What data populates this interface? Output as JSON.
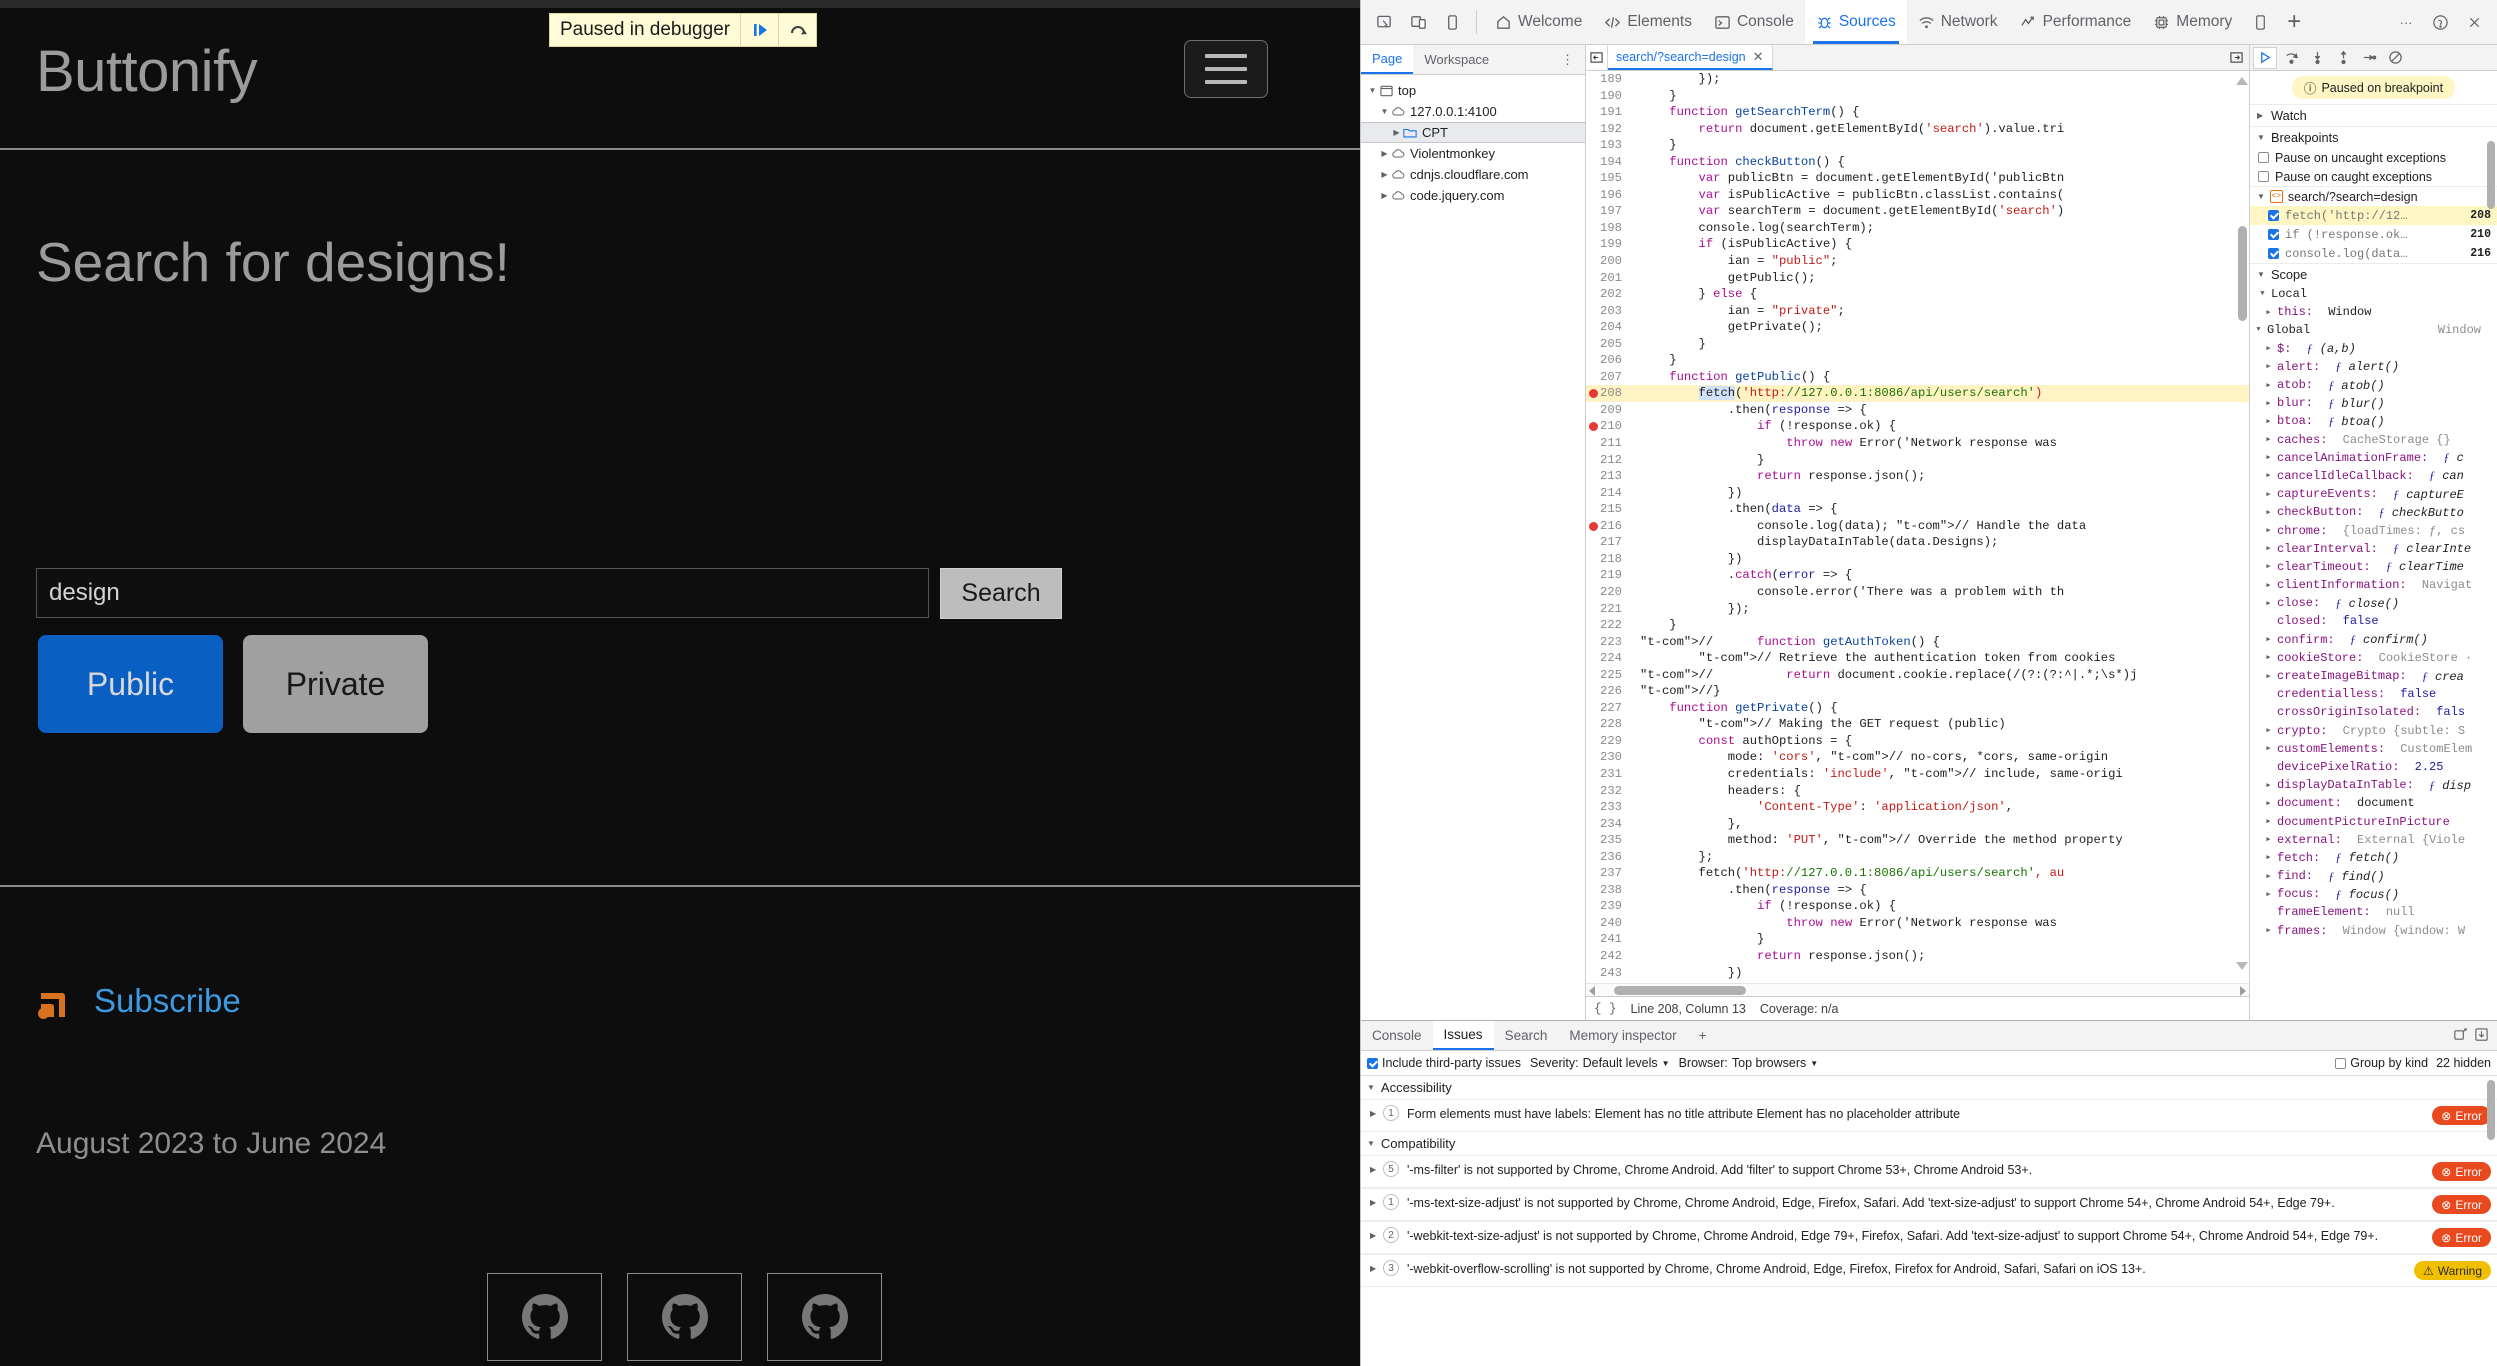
{
  "page": {
    "brand": "Buttonify",
    "paused_banner": {
      "label": "Paused in debugger",
      "resume_icon": "resume-icon",
      "step_icon": "step-over-icon"
    },
    "headline": "Search for designs!",
    "search": {
      "value": "design",
      "button": "Search"
    },
    "filters": [
      {
        "label": "Public",
        "active": true,
        "color": "#0a5fc2"
      },
      {
        "label": "Private",
        "active": false,
        "color": "#a0a0a0"
      }
    ],
    "footer": {
      "subscribe": "Subscribe",
      "dates": "August 2023 to June 2024",
      "github_links": [
        "github-icon",
        "github-icon",
        "github-icon"
      ]
    }
  },
  "devtools": {
    "toolbar": {
      "left_icons": [
        "inspect-element-icon",
        "device-toolbar-icon",
        "device-icon"
      ],
      "tabs": [
        {
          "label": "Welcome",
          "icon": "home-icon",
          "active": false
        },
        {
          "label": "Elements",
          "icon": "code-icon",
          "active": false
        },
        {
          "label": "Console",
          "icon": "console-icon",
          "active": false
        },
        {
          "label": "Sources",
          "icon": "bug-icon",
          "active": true
        },
        {
          "label": "Network",
          "icon": "network-icon",
          "active": false
        },
        {
          "label": "Performance",
          "icon": "performance-icon",
          "active": false
        },
        {
          "label": "Memory",
          "icon": "memory-icon",
          "active": false
        }
      ],
      "more_icon": "more-tabs-icon",
      "plus": "+",
      "right_icons": [
        "settings-more-icon",
        "help-icon",
        "close-icon"
      ]
    },
    "navigator": {
      "tabs": [
        {
          "label": "Page",
          "active": true
        },
        {
          "label": "Workspace",
          "active": false
        }
      ],
      "menu_icon": "kebab-menu-icon",
      "tree": [
        {
          "label": "top",
          "icon": "frame-icon",
          "depth": 0,
          "expanded": true,
          "selected": false
        },
        {
          "label": "127.0.0.1:4100",
          "icon": "cloud-icon",
          "depth": 1,
          "expanded": true,
          "selected": false
        },
        {
          "label": "CPT",
          "icon": "folder-icon",
          "depth": 2,
          "expanded": false,
          "selected": true
        },
        {
          "label": "Violentmonkey",
          "icon": "cloud-icon",
          "depth": 1,
          "expanded": false,
          "selected": false
        },
        {
          "label": "cdnjs.cloudflare.com",
          "icon": "cloud-icon",
          "depth": 1,
          "expanded": false,
          "selected": false
        },
        {
          "label": "code.jquery.com",
          "icon": "cloud-icon",
          "depth": 1,
          "expanded": false,
          "selected": false
        }
      ]
    },
    "editor": {
      "file_tab": "search/?search=design",
      "close_icon": "close-icon",
      "back_icon": "show-navigator-icon",
      "forward_icon": "show-debugger-icon",
      "status": {
        "brace": "{ }",
        "position": "Line 208, Column 13",
        "coverage": "Coverage: n/a"
      },
      "first_line": 189,
      "highlight_line": 208,
      "breakpoint_lines": [
        208,
        210,
        216
      ],
      "lines": [
        "        });",
        "    }",
        "    function getSearchTerm() {",
        "        return document.getElementById('search').value.tri",
        "    }",
        "    function checkButton() {",
        "        var publicBtn = document.getElementById('publicBtn",
        "        var isPublicActive = publicBtn.classList.contains(",
        "        var searchTerm = document.getElementById('search')",
        "        console.log(searchTerm);",
        "        if (isPublicActive) {",
        "            ian = \"public\";",
        "            getPublic();",
        "        } else {",
        "            ian = \"private\";",
        "            getPrivate();",
        "        }",
        "    }",
        "    function getPublic() {",
        "        fetch('http://127.0.0.1:8086/api/users/search')",
        "            .then(response => {",
        "                if (!response.ok) {",
        "                    throw new Error('Network response was",
        "                }",
        "                return response.json();",
        "            })",
        "            .then(data => {",
        "                console.log(data); // Handle the data",
        "                displayDataInTable(data.Designs);",
        "            })",
        "            .catch(error => {",
        "                console.error('There was a problem with th",
        "            });",
        "    }",
        "//      function getAuthToken() {",
        "        // Retrieve the authentication token from cookies",
        "//          return document.cookie.replace(/(?:(?:^|.*;\\s*)j",
        "//}",
        "    function getPrivate() {",
        "        // Making the GET request (public)",
        "        const authOptions = {",
        "            mode: 'cors', // no-cors, *cors, same-origin",
        "            credentials: 'include', // include, same-origi",
        "            headers: {",
        "                'Content-Type': 'application/json',",
        "            },",
        "            method: 'PUT', // Override the method property",
        "        };",
        "        fetch('http://127.0.0.1:8086/api/users/search', au",
        "            .then(response => {",
        "                if (!response.ok) {",
        "                    throw new Error('Network response was",
        "                }",
        "                return response.json();",
        "            })"
      ]
    },
    "debugger": {
      "controls": [
        "resume-icon",
        "step-over-icon",
        "step-into-icon",
        "step-out-icon",
        "step-icon",
        "deactivate-breakpoints-icon"
      ],
      "pause_status": {
        "icon": "info-icon",
        "label": "Paused on breakpoint"
      },
      "watch": {
        "label": "Watch",
        "expanded": false
      },
      "breakpoints": {
        "label": "Breakpoints",
        "expanded": true,
        "pause_uncaught": {
          "label": "Pause on uncaught exceptions",
          "checked": false
        },
        "pause_caught": {
          "label": "Pause on caught exceptions",
          "checked": false
        },
        "file": "search/?search=design",
        "items": [
          {
            "text": "fetch('http://12…",
            "line": "208",
            "checked": true,
            "active": true
          },
          {
            "text": "if (!response.ok…",
            "line": "210",
            "checked": true,
            "active": false
          },
          {
            "text": "console.log(data…",
            "line": "216",
            "checked": true,
            "active": false
          }
        ]
      },
      "scope": {
        "label": "Scope",
        "expanded": true,
        "groups": [
          {
            "name": "Local",
            "value": "",
            "expanded": true
          },
          {
            "name": "Global",
            "value": "Window",
            "expanded": true
          }
        ],
        "local_vars": [
          {
            "name": "this",
            "value": "Window",
            "kind": "plain",
            "expandable": true
          }
        ],
        "global_vars": [
          {
            "name": "$",
            "value": "ƒ (a,b)",
            "kind": "fn",
            "expandable": true
          },
          {
            "name": "alert",
            "value": "ƒ alert()",
            "kind": "fn",
            "expandable": true
          },
          {
            "name": "atob",
            "value": "ƒ atob()",
            "kind": "fn",
            "expandable": true
          },
          {
            "name": "blur",
            "value": "ƒ blur()",
            "kind": "fn",
            "expandable": true
          },
          {
            "name": "btoa",
            "value": "ƒ btoa()",
            "kind": "fn",
            "expandable": true
          },
          {
            "name": "caches",
            "value": "CacheStorage {}",
            "kind": "gray",
            "expandable": true
          },
          {
            "name": "cancelAnimationFrame",
            "value": "ƒ c",
            "kind": "fn",
            "expandable": true
          },
          {
            "name": "cancelIdleCallback",
            "value": "ƒ can",
            "kind": "fn",
            "expandable": true
          },
          {
            "name": "captureEvents",
            "value": "ƒ captureE",
            "kind": "fn",
            "expandable": true
          },
          {
            "name": "checkButton",
            "value": "ƒ checkButto",
            "kind": "fn",
            "expandable": true
          },
          {
            "name": "chrome",
            "value": "{loadTimes: ƒ, cs",
            "kind": "gray",
            "expandable": true
          },
          {
            "name": "clearInterval",
            "value": "ƒ clearInte",
            "kind": "fn",
            "expandable": true
          },
          {
            "name": "clearTimeout",
            "value": "ƒ clearTime",
            "kind": "fn",
            "expandable": true
          },
          {
            "name": "clientInformation",
            "value": "Navigat",
            "kind": "gray",
            "expandable": true
          },
          {
            "name": "close",
            "value": "ƒ close()",
            "kind": "fn",
            "expandable": true
          },
          {
            "name": "closed",
            "value": "false",
            "kind": "val",
            "expandable": false
          },
          {
            "name": "confirm",
            "value": "ƒ confirm()",
            "kind": "fn",
            "expandable": true
          },
          {
            "name": "cookieStore",
            "value": "CookieStore ·",
            "kind": "gray",
            "expandable": true
          },
          {
            "name": "createImageBitmap",
            "value": "ƒ crea",
            "kind": "fn",
            "expandable": true
          },
          {
            "name": "credentialless",
            "value": "false",
            "kind": "val",
            "expandable": false
          },
          {
            "name": "crossOriginIsolated",
            "value": "fals",
            "kind": "val",
            "expandable": false
          },
          {
            "name": "crypto",
            "value": "Crypto {subtle: S",
            "kind": "gray",
            "expandable": true
          },
          {
            "name": "customElements",
            "value": "CustomElem",
            "kind": "gray",
            "expandable": true
          },
          {
            "name": "devicePixelRatio",
            "value": "2.25",
            "kind": "val",
            "expandable": false
          },
          {
            "name": "displayDataInTable",
            "value": "ƒ disp",
            "kind": "fn",
            "expandable": true
          },
          {
            "name": "document",
            "value": "document",
            "kind": "plain",
            "expandable": true
          },
          {
            "name": "documentPictureInPicture",
            "value": "",
            "kind": "plain",
            "expandable": true
          },
          {
            "name": "external",
            "value": "External {Viole",
            "kind": "gray",
            "expandable": true
          },
          {
            "name": "fetch",
            "value": "ƒ fetch()",
            "kind": "fn",
            "expandable": true
          },
          {
            "name": "find",
            "value": "ƒ find()",
            "kind": "fn",
            "expandable": true
          },
          {
            "name": "focus",
            "value": "ƒ focus()",
            "kind": "fn",
            "expandable": true
          },
          {
            "name": "frameElement",
            "value": "null",
            "kind": "gray",
            "expandable": false
          },
          {
            "name": "frames",
            "value": "Window {window: W",
            "kind": "gray",
            "expandable": true
          }
        ]
      }
    },
    "drawer": {
      "tabs": [
        {
          "label": "Console",
          "active": false
        },
        {
          "label": "Issues",
          "active": true
        },
        {
          "label": "Search",
          "active": false
        },
        {
          "label": "Memory inspector",
          "active": false
        }
      ],
      "plus": "+",
      "right_icons": [
        "open-in-new-icon",
        "download-icon"
      ],
      "filters": {
        "include_third_party": {
          "label": "Include third-party issues",
          "checked": true
        },
        "severity": {
          "label": "Severity:",
          "value": "Default levels"
        },
        "browser": {
          "label": "Browser:",
          "value": "Top browsers"
        },
        "group_by_kind": {
          "label": "Group by kind",
          "checked": false
        },
        "hidden": "22 hidden"
      },
      "categories": [
        {
          "name": "Accessibility",
          "issues": [
            {
              "count": "1",
              "text": "Form elements must have labels: Element has no title attribute Element has no placeholder attribute",
              "severity": "Error"
            }
          ]
        },
        {
          "name": "Compatibility",
          "issues": [
            {
              "count": "5",
              "text": "'-ms-filter' is not supported by Chrome, Chrome Android. Add 'filter' to support Chrome 53+, Chrome Android 53+.",
              "severity": "Error"
            },
            {
              "count": "1",
              "text": "'-ms-text-size-adjust' is not supported by Chrome, Chrome Android, Edge, Firefox, Safari. Add 'text-size-adjust' to support Chrome 54+, Chrome Android 54+, Edge 79+.",
              "severity": "Error"
            },
            {
              "count": "2",
              "text": "'-webkit-text-size-adjust' is not supported by Chrome, Chrome Android, Edge 79+, Firefox, Safari. Add 'text-size-adjust' to support Chrome 54+, Chrome Android 54+, Edge 79+.",
              "severity": "Error"
            },
            {
              "count": "3",
              "text": "'-webkit-overflow-scrolling' is not supported by Chrome, Chrome Android, Edge, Firefox, Firefox for Android, Safari, Safari on iOS 13+.",
              "severity": "Warning"
            }
          ]
        }
      ]
    }
  }
}
